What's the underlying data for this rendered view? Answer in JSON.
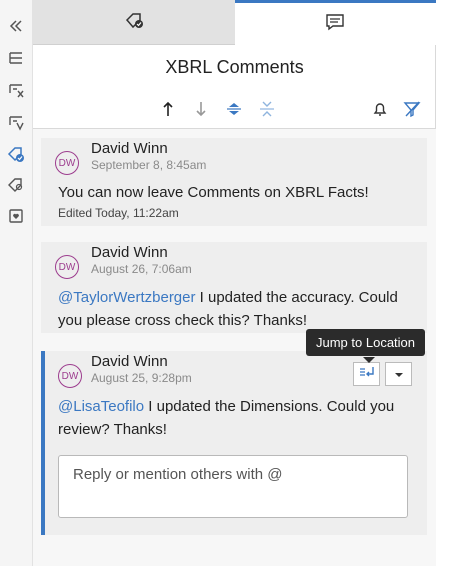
{
  "rail": {
    "items": [
      {
        "icon": "collapse-icon"
      },
      {
        "icon": "outline-icon"
      },
      {
        "icon": "formula-icon"
      },
      {
        "icon": "filter-icon"
      },
      {
        "icon": "tag-check-icon"
      },
      {
        "icon": "tag-search-icon"
      },
      {
        "icon": "favorite-icon"
      }
    ]
  },
  "tabs": [
    {
      "icon": "tag-check-icon",
      "active": false
    },
    {
      "icon": "comment-icon",
      "active": true
    }
  ],
  "header": {
    "title": "XBRL Comments"
  },
  "sortbar": {
    "buttons": [
      "sort-up-icon",
      "sort-down-icon",
      "expand-icon",
      "collapse-all-icon",
      "bell-icon",
      "clear-filter-icon"
    ]
  },
  "comments": [
    {
      "initials": "DW",
      "author": "David Winn",
      "time": "September 8, 8:45am",
      "text": "You can now leave Comments on XBRL Facts!",
      "edited": "Edited Today, 11:22am"
    },
    {
      "initials": "DW",
      "author": "David Winn",
      "time": "August 26, 7:06am",
      "mention": "@TaylorWertzberger",
      "text": " I updated the accuracy. Could you please cross check this? Thanks!"
    },
    {
      "initials": "DW",
      "author": "David Winn",
      "time": "August 25, 9:28pm",
      "mention": "@LisaTeofilo",
      "text": " I updated the Dimensions. Could you review? Thanks!",
      "tooltip": "Jump to Location",
      "reply_placeholder": "Reply or mention others with @"
    }
  ],
  "colors": {
    "accent": "#3b78c2",
    "avatar": "#9c3c8e",
    "card": "#eeeeee"
  }
}
